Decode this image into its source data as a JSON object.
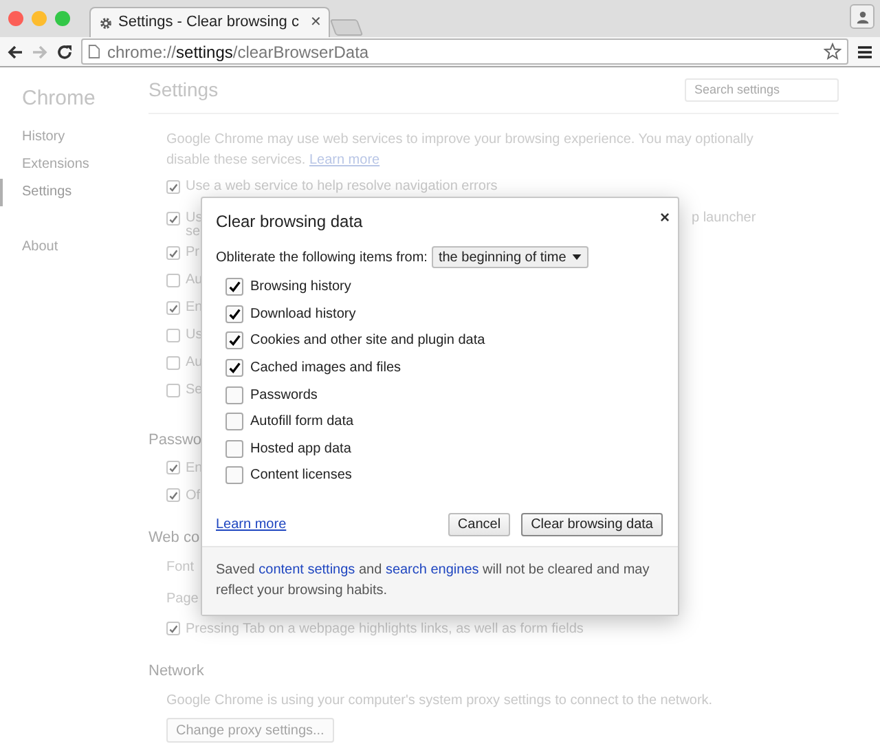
{
  "browser": {
    "tab_title": "Settings - Clear browsing c",
    "tab_close": "✕",
    "url_scheme": "chrome://",
    "url_host": "settings",
    "url_path": "/clearBrowserData"
  },
  "sidebar": {
    "title": "Chrome",
    "items": [
      {
        "label": "History",
        "selected": false
      },
      {
        "label": "Extensions",
        "selected": false
      },
      {
        "label": "Settings",
        "selected": true
      }
    ],
    "footer_item": "About"
  },
  "settings": {
    "title": "Settings",
    "search_placeholder": "Search settings",
    "intro": "Google Chrome may use web services to improve your browsing experience. You may optionally disable these services.",
    "intro_link": "Learn more",
    "options": [
      {
        "label": "Use a web service to help resolve navigation errors",
        "checked": true
      },
      {
        "label": "Us",
        "second_line": "se",
        "right_fragment": "p launcher",
        "checked": true
      },
      {
        "label": "Pr",
        "checked": true
      },
      {
        "label": "Au",
        "checked": false
      },
      {
        "label": "En",
        "checked": true
      },
      {
        "label": "Us",
        "checked": false
      },
      {
        "label": "Au",
        "checked": false
      },
      {
        "label": "Se",
        "checked": false
      }
    ],
    "sections": [
      {
        "title": "Passwo",
        "items": [
          {
            "kind": "checkbox",
            "label": "En",
            "checked": true
          },
          {
            "kind": "checkbox",
            "label": "Of",
            "checked": true
          }
        ]
      },
      {
        "title": "Web co",
        "items": [
          {
            "kind": "text",
            "label": "Font"
          },
          {
            "kind": "text",
            "label": "Page"
          },
          {
            "kind": "checkbox",
            "label": "Pressing Tab on a webpage highlights links, as well as form fields",
            "checked": true
          }
        ]
      },
      {
        "title": "Network",
        "items": [
          {
            "kind": "text",
            "label": "Google Chrome is using your computer's system proxy settings to connect to the network."
          },
          {
            "kind": "button",
            "label": "Change proxy settings..."
          }
        ]
      }
    ]
  },
  "dialog": {
    "title": "Clear browsing data",
    "close": "×",
    "period_label": "Obliterate the following items from:",
    "period_value": "the beginning of time",
    "items": [
      {
        "label": "Browsing history",
        "checked": true
      },
      {
        "label": "Download history",
        "checked": true
      },
      {
        "label": "Cookies and other site and plugin data",
        "checked": true
      },
      {
        "label": "Cached images and files",
        "checked": true
      },
      {
        "label": "Passwords",
        "checked": false
      },
      {
        "label": "Autofill form data",
        "checked": false
      },
      {
        "label": "Hosted app data",
        "checked": false
      },
      {
        "label": "Content licenses",
        "checked": false
      }
    ],
    "learn_more": "Learn more",
    "buttons": [
      "Cancel",
      "Clear browsing data"
    ],
    "footer": {
      "before": "Saved",
      "link1": "content settings",
      "middle": "and",
      "link2": "search engines",
      "after": "will not be cleared and may reflect your browsing habits."
    }
  }
}
